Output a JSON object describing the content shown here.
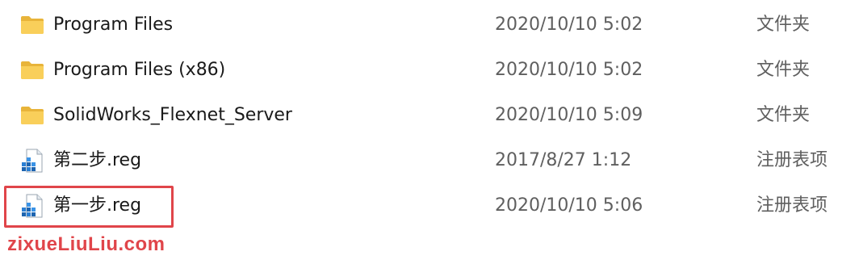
{
  "files": [
    {
      "name": "Program Files",
      "date": "2020/10/10 5:02",
      "type": "文件夹",
      "icon": "folder-icon"
    },
    {
      "name": "Program Files (x86)",
      "date": "2020/10/10 5:02",
      "type": "文件夹",
      "icon": "folder-icon"
    },
    {
      "name": "SolidWorks_Flexnet_Server",
      "date": "2020/10/10 5:09",
      "type": "文件夹",
      "icon": "folder-icon"
    },
    {
      "name": "第二步.reg",
      "date": "2017/8/27 1:12",
      "type": "注册表项",
      "icon": "registry-file-icon"
    },
    {
      "name": "第一步.reg",
      "date": "2020/10/10 5:06",
      "type": "注册表项",
      "icon": "registry-file-icon"
    }
  ],
  "watermark": "zixueLiuLiu.com",
  "colors": {
    "highlight": "#e0454a",
    "folder": "#f7c84a",
    "registry": "#2a7fd4"
  }
}
